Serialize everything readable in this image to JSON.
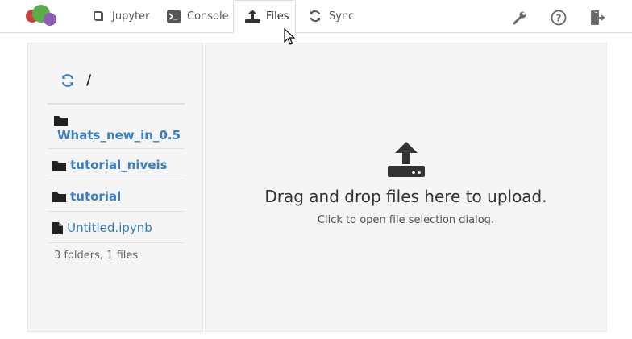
{
  "colors": {
    "accent": "#3a7fc1",
    "panel": "#f5f5f5",
    "icon": "#333333"
  },
  "nav": {
    "tabs": [
      {
        "label": "Jupyter",
        "icon": "book-icon",
        "active": false
      },
      {
        "label": "Console",
        "icon": "terminal-icon",
        "active": false
      },
      {
        "label": "Files",
        "icon": "upload-icon",
        "active": true
      },
      {
        "label": "Sync",
        "icon": "sync-icon",
        "active": false
      }
    ],
    "right_icons": [
      "wrench-icon",
      "help-icon",
      "logout-icon"
    ]
  },
  "sidebar": {
    "path": "/",
    "items": [
      {
        "name": "Whats_new_in_0.5",
        "type": "folder"
      },
      {
        "name": "tutorial_niveis",
        "type": "folder"
      },
      {
        "name": "tutorial",
        "type": "folder"
      },
      {
        "name": "Untitled.ipynb",
        "type": "file"
      }
    ],
    "summary": "3 folders, 1 files"
  },
  "dropzone": {
    "title": "Drag and drop files here to upload.",
    "subtitle": "Click to open file selection dialog."
  }
}
